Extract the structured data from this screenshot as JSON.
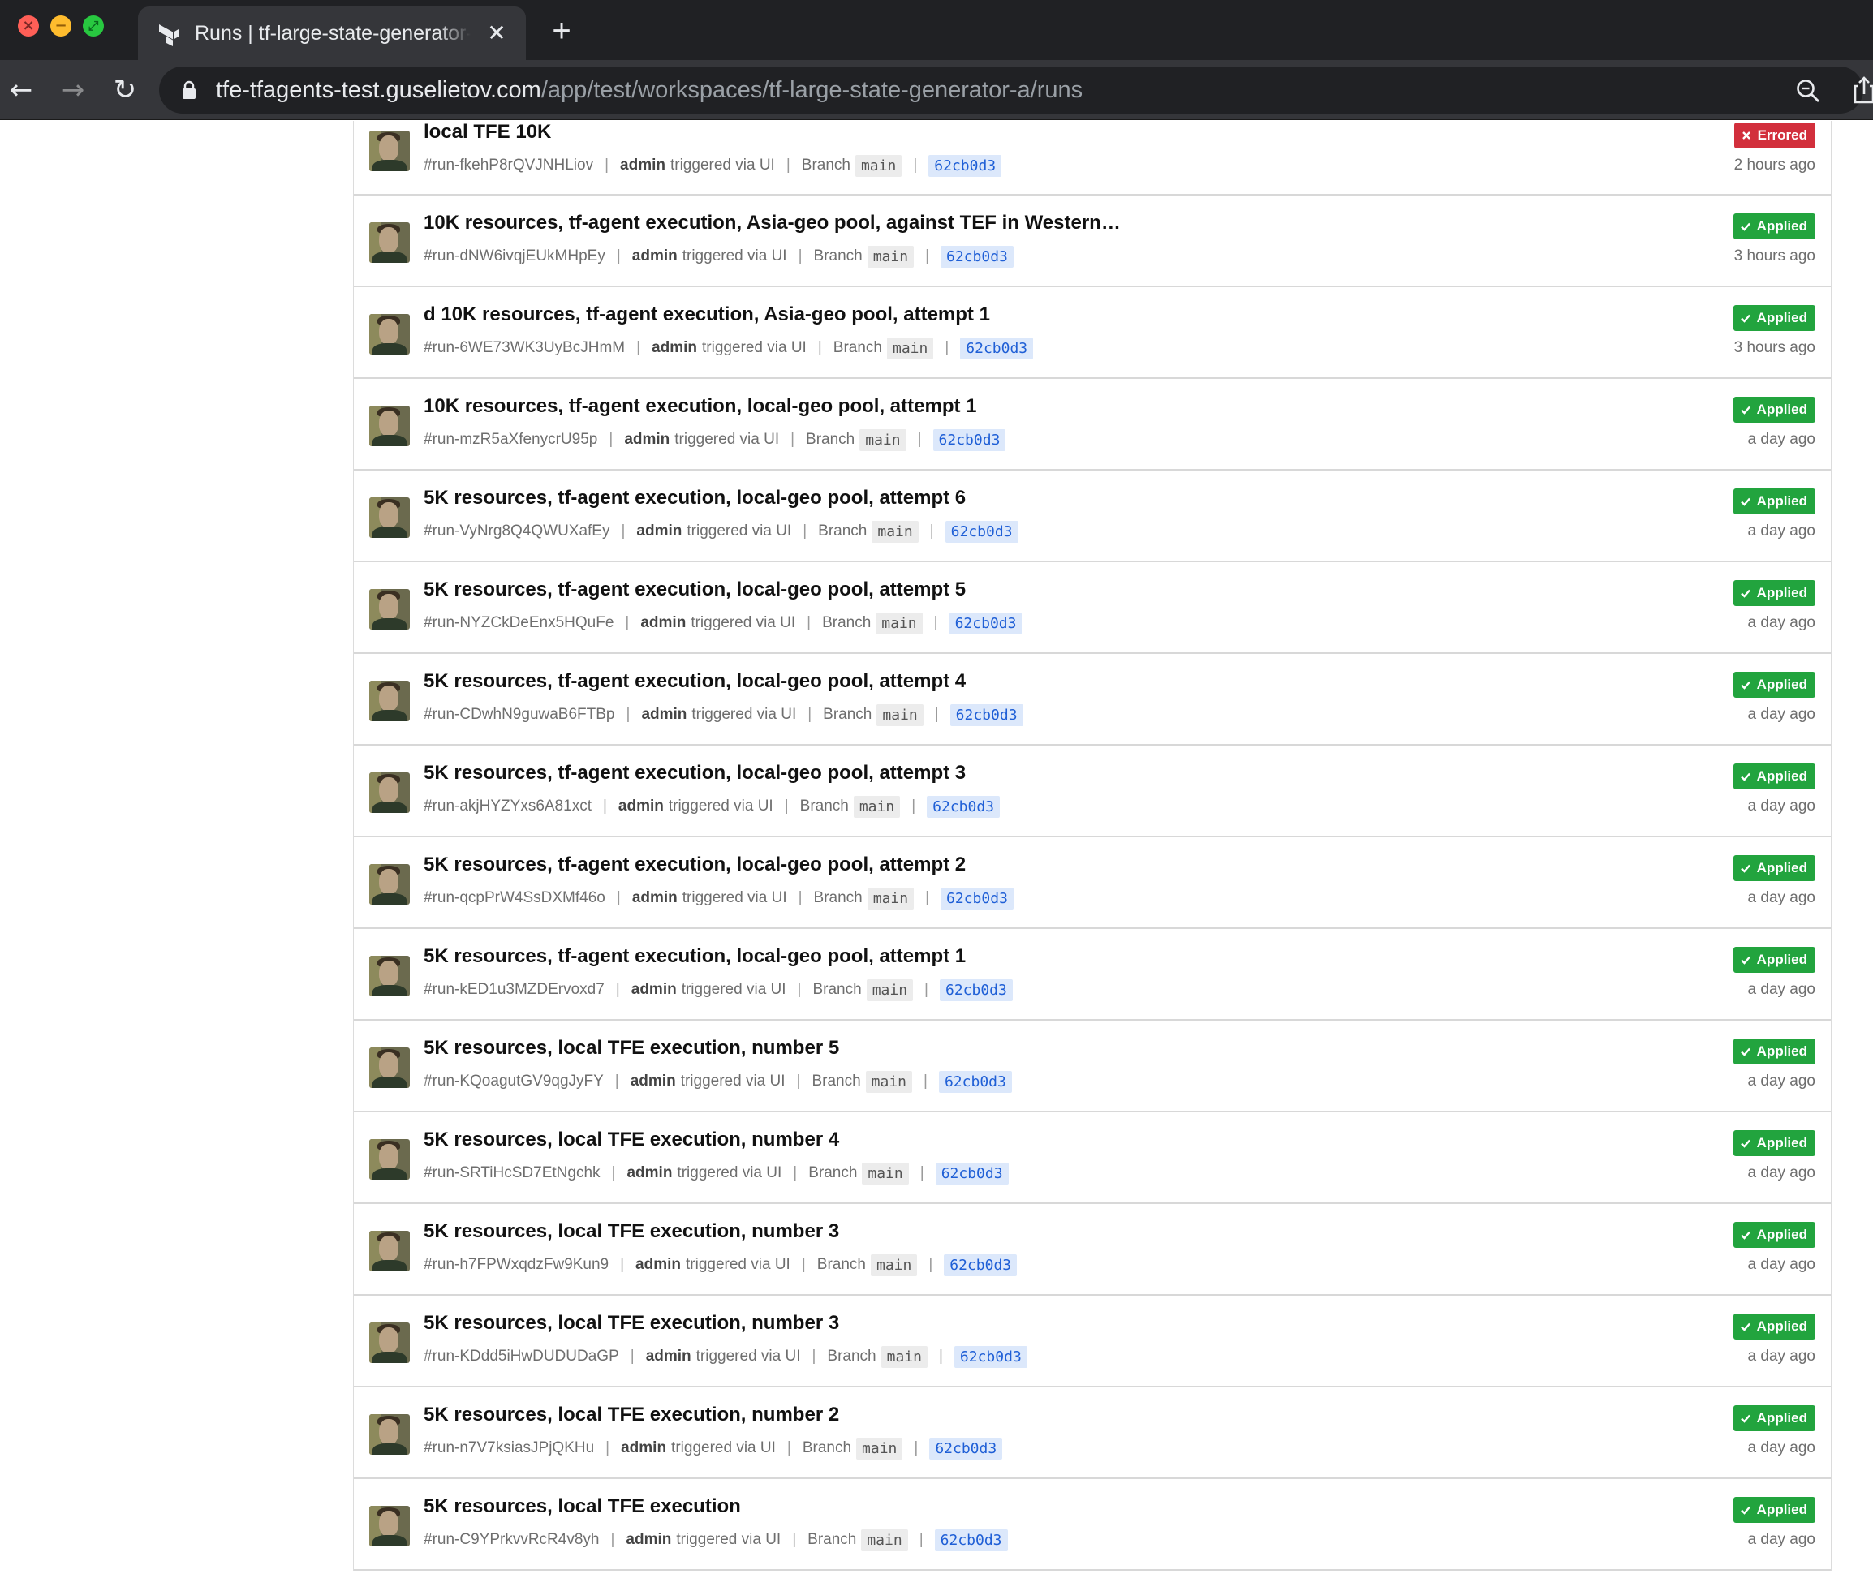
{
  "browser": {
    "tab_title": "Runs | tf-large-state-generator-a",
    "url_host": "tfe-tfagents-test.guselietov.com",
    "url_path": "/app/test/workspaces/tf-large-state-generator-a/runs"
  },
  "labels": {
    "triggered_via": "triggered via UI",
    "branch": "Branch"
  },
  "colors": {
    "applied": "#22a43e",
    "errored": "#d22f3c",
    "sha_text": "#1f5fd6",
    "sha_bg": "#dce8fb"
  },
  "runs": [
    {
      "title": "local TFE 10K",
      "id": "#run-fkehP8rQVJNHLiov",
      "user": "admin",
      "branch": "main",
      "commit": "62cb0d3",
      "status": "Errored",
      "time": "2 hours ago"
    },
    {
      "title": "10K resources, tf-agent execution, Asia-geo pool, against TEF in Western…",
      "id": "#run-dNW6ivqjEUkMHpEy",
      "user": "admin",
      "branch": "main",
      "commit": "62cb0d3",
      "status": "Applied",
      "time": "3 hours ago"
    },
    {
      "title": "d 10K resources, tf-agent execution, Asia-geo pool, attempt 1",
      "id": "#run-6WE73WK3UyBcJHmM",
      "user": "admin",
      "branch": "main",
      "commit": "62cb0d3",
      "status": "Applied",
      "time": "3 hours ago"
    },
    {
      "title": "10K resources, tf-agent execution, local-geo pool, attempt 1",
      "id": "#run-mzR5aXfenycrU95p",
      "user": "admin",
      "branch": "main",
      "commit": "62cb0d3",
      "status": "Applied",
      "time": "a day ago"
    },
    {
      "title": "5K resources, tf-agent execution, local-geo pool, attempt 6",
      "id": "#run-VyNrg8Q4QWUXafEy",
      "user": "admin",
      "branch": "main",
      "commit": "62cb0d3",
      "status": "Applied",
      "time": "a day ago"
    },
    {
      "title": "5K resources, tf-agent execution, local-geo pool, attempt 5",
      "id": "#run-NYZCkDeEnx5HQuFe",
      "user": "admin",
      "branch": "main",
      "commit": "62cb0d3",
      "status": "Applied",
      "time": "a day ago"
    },
    {
      "title": "5K resources, tf-agent execution, local-geo pool, attempt 4",
      "id": "#run-CDwhN9guwaB6FTBp",
      "user": "admin",
      "branch": "main",
      "commit": "62cb0d3",
      "status": "Applied",
      "time": "a day ago"
    },
    {
      "title": "5K resources, tf-agent execution, local-geo pool, attempt 3",
      "id": "#run-akjHYZYxs6A81xct",
      "user": "admin",
      "branch": "main",
      "commit": "62cb0d3",
      "status": "Applied",
      "time": "a day ago"
    },
    {
      "title": "5K resources, tf-agent execution, local-geo pool, attempt 2",
      "id": "#run-qcpPrW4SsDXMf46o",
      "user": "admin",
      "branch": "main",
      "commit": "62cb0d3",
      "status": "Applied",
      "time": "a day ago"
    },
    {
      "title": "5K resources, tf-agent execution, local-geo pool, attempt 1",
      "id": "#run-kED1u3MZDErvoxd7",
      "user": "admin",
      "branch": "main",
      "commit": "62cb0d3",
      "status": "Applied",
      "time": "a day ago"
    },
    {
      "title": "5K resources, local TFE execution, number 5",
      "id": "#run-KQoagutGV9qgJyFY",
      "user": "admin",
      "branch": "main",
      "commit": "62cb0d3",
      "status": "Applied",
      "time": "a day ago"
    },
    {
      "title": "5K resources, local TFE execution, number 4",
      "id": "#run-SRTiHcSD7EtNgchk",
      "user": "admin",
      "branch": "main",
      "commit": "62cb0d3",
      "status": "Applied",
      "time": "a day ago"
    },
    {
      "title": "5K resources, local TFE execution, number 3",
      "id": "#run-h7FPWxqdzFw9Kun9",
      "user": "admin",
      "branch": "main",
      "commit": "62cb0d3",
      "status": "Applied",
      "time": "a day ago"
    },
    {
      "title": "5K resources, local TFE execution, number 3",
      "id": "#run-KDdd5iHwDUDUDaGP",
      "user": "admin",
      "branch": "main",
      "commit": "62cb0d3",
      "status": "Applied",
      "time": "a day ago"
    },
    {
      "title": "5K resources, local TFE execution, number 2",
      "id": "#run-n7V7ksiasJPjQKHu",
      "user": "admin",
      "branch": "main",
      "commit": "62cb0d3",
      "status": "Applied",
      "time": "a day ago"
    },
    {
      "title": "5K resources, local TFE execution",
      "id": "#run-C9YPrkvvRcR4v8yh",
      "user": "admin",
      "branch": "main",
      "commit": "62cb0d3",
      "status": "Applied",
      "time": "a day ago"
    }
  ]
}
